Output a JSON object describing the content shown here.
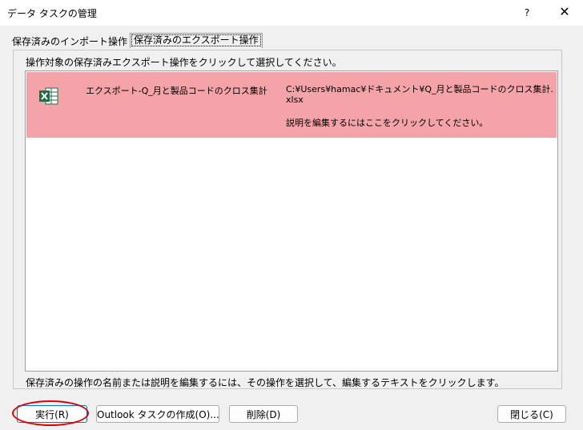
{
  "window": {
    "title": "データ タスクの管理",
    "help": "?",
    "close": "✕"
  },
  "tabs": [
    {
      "label": "保存済みのインポート操作",
      "selected": false
    },
    {
      "label": "保存済みのエクスポート操作",
      "selected": true
    }
  ],
  "instruction": "操作対象の保存済みエクスポート操作をクリックして選択してください。",
  "list": {
    "items": [
      {
        "icon": "excel-icon",
        "name": "エクスポート-Q_月と製品コードのクロス集計",
        "path_line1": "C:¥Users¥hamac¥ドキュメント¥Q_月と製品コードのクロス集計.",
        "path_line2": "xlsx",
        "description": "説明を編集するにはここをクリックしてください。",
        "selected": true
      }
    ]
  },
  "hint": "保存済みの操作の名前または説明を編集するには、その操作を選択して、編集するテキストをクリックします。",
  "buttons": {
    "run": "実行(R)",
    "outlook": "Outlook タスクの作成(O)...",
    "delete": "削除(D)",
    "close": "閉じる(C)"
  },
  "colors": {
    "selected_row": "#f4a3a8",
    "highlight_ellipse": "#e10000",
    "excel_green": "#1d7044"
  }
}
